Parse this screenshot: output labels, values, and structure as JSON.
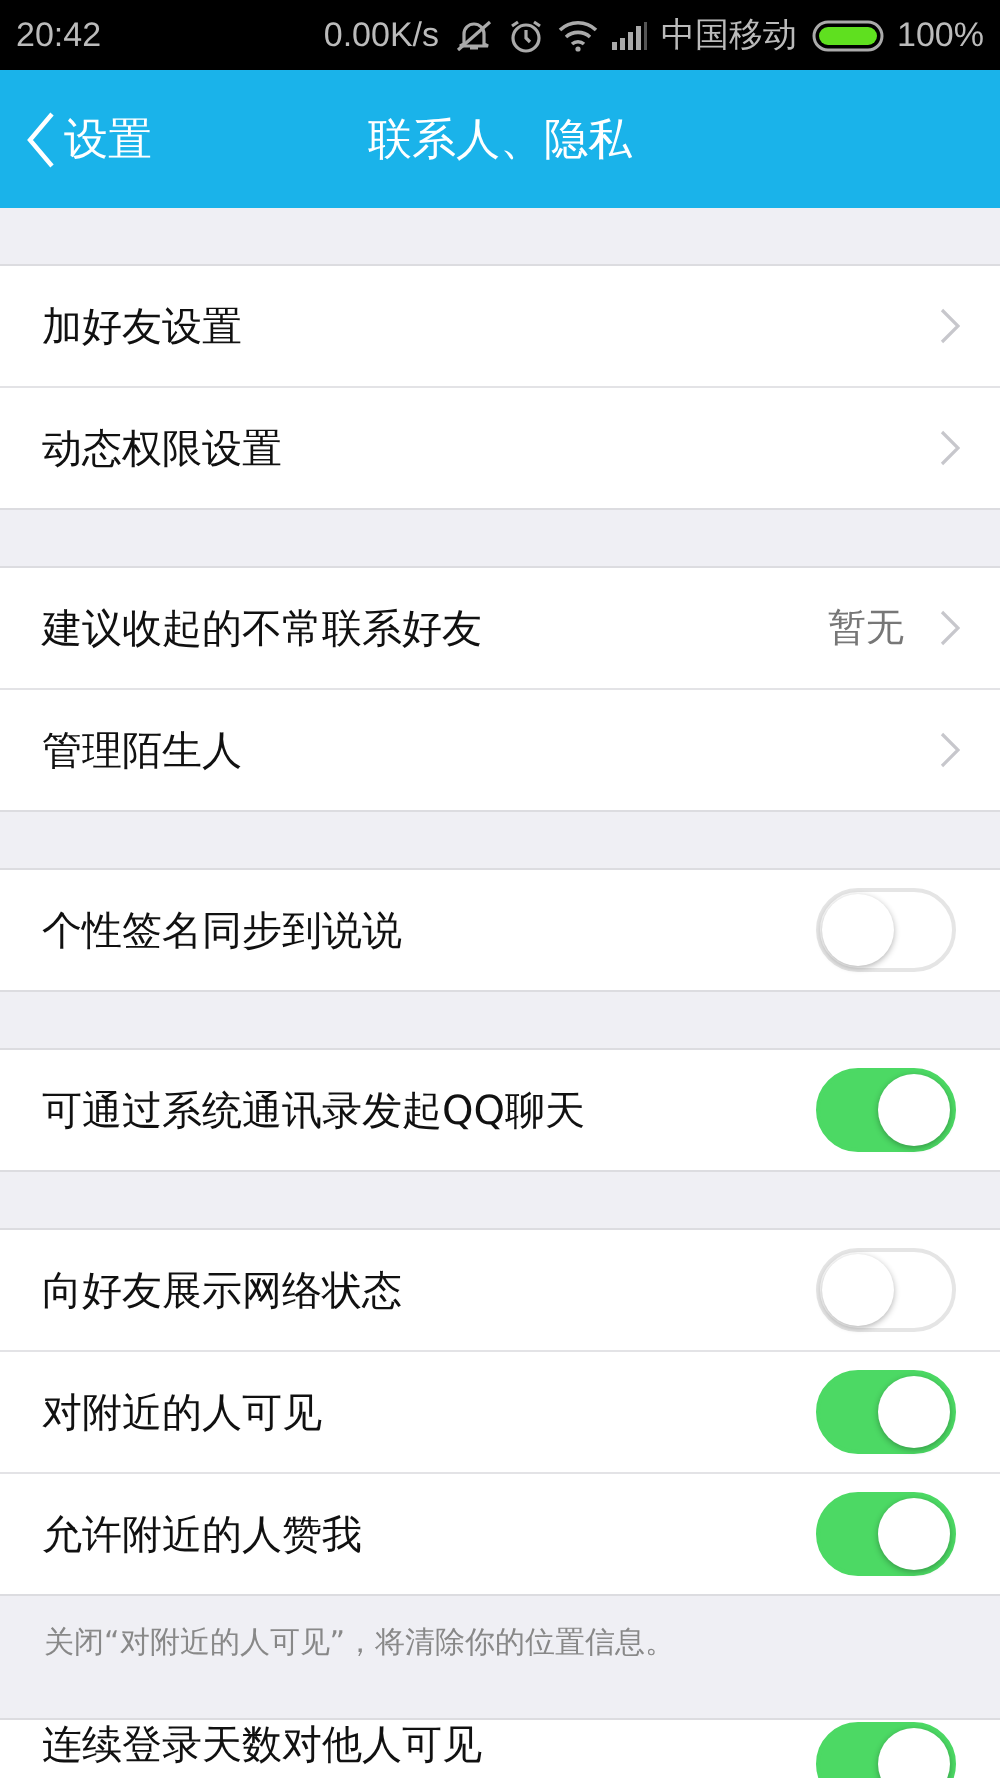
{
  "status_bar": {
    "time": "20:42",
    "speed": "0.00K/s",
    "carrier": "中国移动",
    "battery": "100%"
  },
  "nav": {
    "back": "设置",
    "title": "联系人、隐私"
  },
  "groups": [
    {
      "rows": [
        {
          "kind": "link",
          "label": "加好友设置"
        },
        {
          "kind": "link",
          "label": "动态权限设置"
        }
      ]
    },
    {
      "rows": [
        {
          "kind": "link",
          "label": "建议收起的不常联系好友",
          "value": "暂无"
        },
        {
          "kind": "link",
          "label": "管理陌生人"
        }
      ]
    },
    {
      "rows": [
        {
          "kind": "toggle",
          "label": "个性签名同步到说说",
          "on": false
        }
      ]
    },
    {
      "rows": [
        {
          "kind": "toggle",
          "label": "可通过系统通讯录发起QQ聊天",
          "on": true
        }
      ]
    },
    {
      "rows": [
        {
          "kind": "toggle",
          "label": "向好友展示网络状态",
          "on": false
        },
        {
          "kind": "toggle",
          "label": "对附近的人可见",
          "on": true
        },
        {
          "kind": "toggle",
          "label": "允许附近的人赞我",
          "on": true
        }
      ],
      "note": "关闭“对附近的人可见”，将清除你的位置信息。"
    },
    {
      "rows": [
        {
          "kind": "toggle",
          "label": "连续登录天数对他人可见",
          "on": true
        }
      ]
    }
  ]
}
